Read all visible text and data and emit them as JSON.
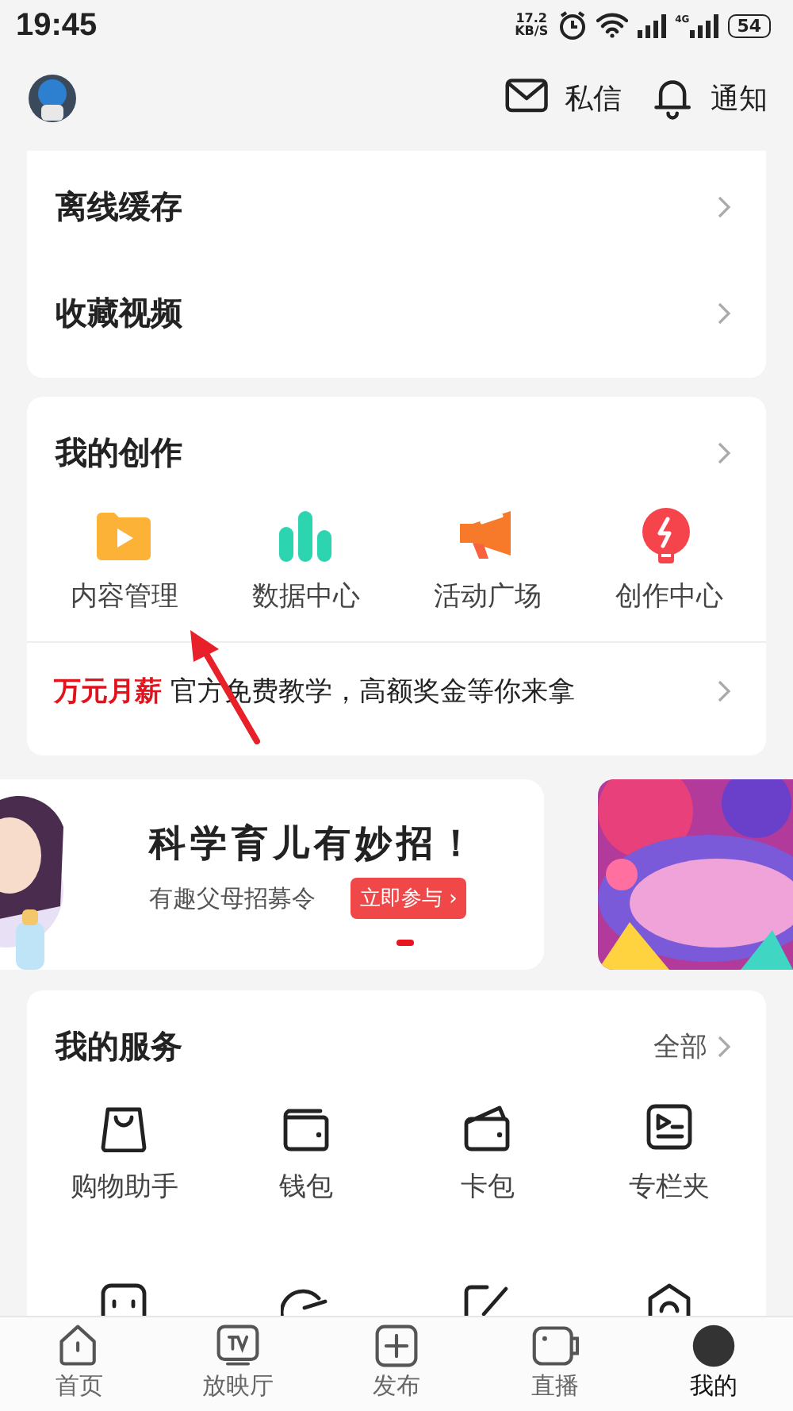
{
  "status_bar": {
    "time": "19:45",
    "speed_value": "17.2",
    "speed_unit": "KB/S",
    "network": "4G",
    "battery": "54"
  },
  "header": {
    "actions": [
      {
        "kind": "mail",
        "label": "私信"
      },
      {
        "kind": "bell",
        "label": "通知"
      }
    ]
  },
  "list_card": {
    "rows": [
      "离线缓存",
      "收藏视频"
    ]
  },
  "creation": {
    "title": "我的创作",
    "tools": [
      {
        "kind": "folder",
        "label": "内容管理"
      },
      {
        "kind": "bars",
        "label": "数据中心"
      },
      {
        "kind": "megaphone",
        "label": "活动广场"
      },
      {
        "kind": "bulb",
        "label": "创作中心"
      }
    ],
    "promo": {
      "highlight": "万元月薪",
      "text": "官方免费教学，高额奖金等你来拿"
    }
  },
  "banner": {
    "title": "科学育儿有妙招！",
    "subtitle": "有趣父母招募令",
    "button": "立即参与 ›"
  },
  "services": {
    "title": "我的服务",
    "more": "全部",
    "items": [
      {
        "kind": "bag",
        "label": "购物助手"
      },
      {
        "kind": "wallet",
        "label": "钱包"
      },
      {
        "kind": "cardcase",
        "label": "卡包"
      },
      {
        "kind": "column",
        "label": "专栏夹"
      }
    ],
    "partial_items": [
      {
        "kind": "face"
      },
      {
        "kind": "pie"
      },
      {
        "kind": "pen"
      },
      {
        "kind": "shield"
      }
    ]
  },
  "tabs": [
    {
      "kind": "home",
      "label": "首页",
      "selected": false
    },
    {
      "kind": "tv",
      "label": "放映厅",
      "selected": false
    },
    {
      "kind": "plus",
      "label": "发布",
      "selected": false
    },
    {
      "kind": "camera",
      "label": "直播",
      "selected": false
    },
    {
      "kind": "avatar",
      "label": "我的",
      "selected": true
    }
  ]
}
